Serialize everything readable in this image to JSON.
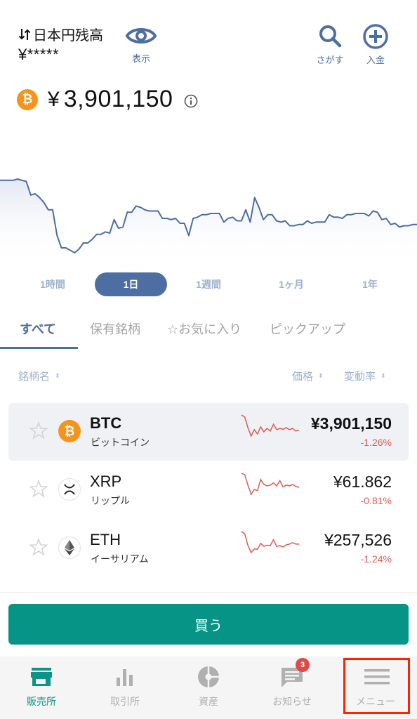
{
  "header": {
    "balance_label": "日本円残高",
    "balance_value": "¥*****",
    "show_button_label": "表示",
    "search_button_label": "さがす",
    "deposit_button_label": "入金"
  },
  "selected_asset": {
    "symbol": "BTC",
    "badge_glyph": "₿",
    "currency_symbol": "¥",
    "price": "3,901,150"
  },
  "chart_data": {
    "type": "area",
    "title": "",
    "xlabel": "",
    "ylabel": "",
    "range": "1日",
    "grid": false,
    "line_color": "#4c6ea2",
    "values": [
      100,
      100,
      100,
      100,
      101,
      100,
      99,
      88,
      89,
      86,
      82,
      76,
      76,
      55,
      45,
      45,
      43,
      41,
      44,
      49,
      49,
      52,
      56,
      56,
      58,
      57,
      68,
      61,
      62,
      74,
      74,
      79,
      78,
      76,
      75,
      75,
      75,
      69,
      69,
      68,
      69,
      65,
      65,
      55,
      69,
      70,
      72,
      72,
      73,
      73,
      73,
      66,
      69,
      70,
      67,
      67,
      76,
      66,
      86,
      78,
      68,
      72,
      72,
      67,
      66,
      67,
      63,
      63,
      64,
      64,
      67,
      65,
      66,
      66,
      66,
      72,
      70,
      70,
      69,
      72,
      72,
      73,
      73,
      73,
      71,
      75,
      74,
      68,
      69,
      64,
      65,
      62,
      63,
      63,
      64,
      64
    ]
  },
  "range_tabs": [
    {
      "label": "1時間",
      "active": false
    },
    {
      "label": "1日",
      "active": true
    },
    {
      "label": "1週間",
      "active": false
    },
    {
      "label": "1ヶ月",
      "active": false
    },
    {
      "label": "1年",
      "active": false
    }
  ],
  "category_tabs": [
    {
      "label": "すべて",
      "active": true
    },
    {
      "label": "保有銘柄",
      "active": false
    },
    {
      "label": "☆お気に入り",
      "active": false
    },
    {
      "label": "ピックアップ",
      "active": false
    }
  ],
  "columns": {
    "name": "銘柄名",
    "price": "価格",
    "change": "変動率",
    "sort_glyph": "⬍"
  },
  "assets": [
    {
      "symbol": "BTC",
      "name": "ビットコイン",
      "price": "¥3,901,150",
      "change": "-1.26%",
      "icon": "bitcoin-icon",
      "selected": true,
      "spark": [
        90,
        85,
        60,
        40,
        55,
        45,
        62,
        50,
        58,
        52,
        68,
        55,
        58,
        56,
        60,
        55,
        58,
        52,
        54
      ]
    },
    {
      "symbol": "XRP",
      "name": "リップル",
      "price": "¥61.862",
      "change": "-0.81%",
      "icon": "xrp-icon",
      "selected": false,
      "spark": [
        92,
        88,
        60,
        35,
        48,
        45,
        75,
        62,
        58,
        60,
        66,
        58,
        72,
        55,
        60,
        58,
        62,
        56,
        54
      ]
    },
    {
      "symbol": "ETH",
      "name": "イーサリアム",
      "price": "¥257,526",
      "change": "-1.24%",
      "icon": "ethereum-icon",
      "selected": false,
      "spark": [
        92,
        86,
        55,
        35,
        45,
        44,
        60,
        52,
        55,
        54,
        70,
        52,
        54,
        50,
        56,
        58,
        62,
        58,
        58
      ]
    }
  ],
  "buy_button_label": "買う",
  "bottom_nav": [
    {
      "label": "販売所",
      "icon": "shop-icon",
      "active": true
    },
    {
      "label": "取引所",
      "icon": "bar-chart-icon",
      "active": false
    },
    {
      "label": "資産",
      "icon": "pie-chart-icon",
      "active": false
    },
    {
      "label": "お知らせ",
      "icon": "message-icon",
      "active": false,
      "badge": "3"
    },
    {
      "label": "メニュー",
      "icon": "menu-icon",
      "active": false
    }
  ],
  "colors": {
    "accent_blue": "#4c6ea2",
    "buy_green": "#069486",
    "negative_red": "#e05a4f",
    "bitcoin_orange": "#f7931a",
    "highlight_red": "#ff2200"
  }
}
